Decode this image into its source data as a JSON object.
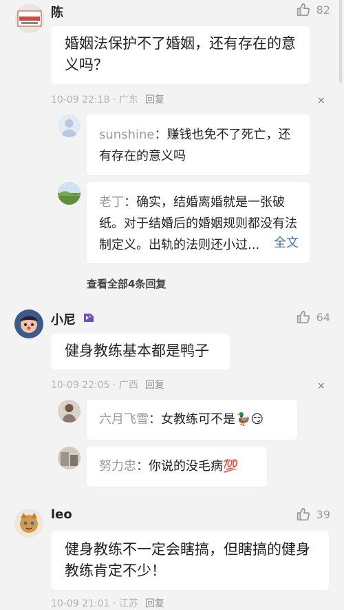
{
  "comments": [
    {
      "user": "陈",
      "likes": "82",
      "text": "婚姻法保护不了婚姻，还有存在的意义吗？",
      "time": "10-09 22:18",
      "location": "广东",
      "reply_label": "回复",
      "replies": [
        {
          "name": "sunshine",
          "sep": "：",
          "text": "赚钱也免不了死亡，还有存在的意义吗"
        },
        {
          "name": "老丁",
          "sep": "：",
          "text": "确实，结婚离婚就是一张破纸。对于结婚后的婚姻规则都没有法制定义。出轨的法则还小过...",
          "more": "全文"
        }
      ],
      "view_all": "查看全部4条回复"
    },
    {
      "user": "小尼",
      "likes": "64",
      "text": "健身教练基本都是鸭子",
      "time": "10-09 22:05",
      "location": "广西",
      "reply_label": "回复",
      "replies": [
        {
          "name": "六月飞雪",
          "sep": "：",
          "text": "女教练可不是🦆😏"
        },
        {
          "name": "努力忠",
          "sep": "：",
          "text": "你说的没毛病💯"
        }
      ]
    },
    {
      "user": "leo",
      "likes": "39",
      "text": "健身教练不一定会瞎搞，但瞎搞的健身教练肯定不少！",
      "time": "10-09 21:01",
      "location": "江苏",
      "reply_label": "回复"
    }
  ],
  "close_symbol": "×",
  "icons": {
    "like": "thumbs-up-icon",
    "badge": "member-badge-icon"
  }
}
